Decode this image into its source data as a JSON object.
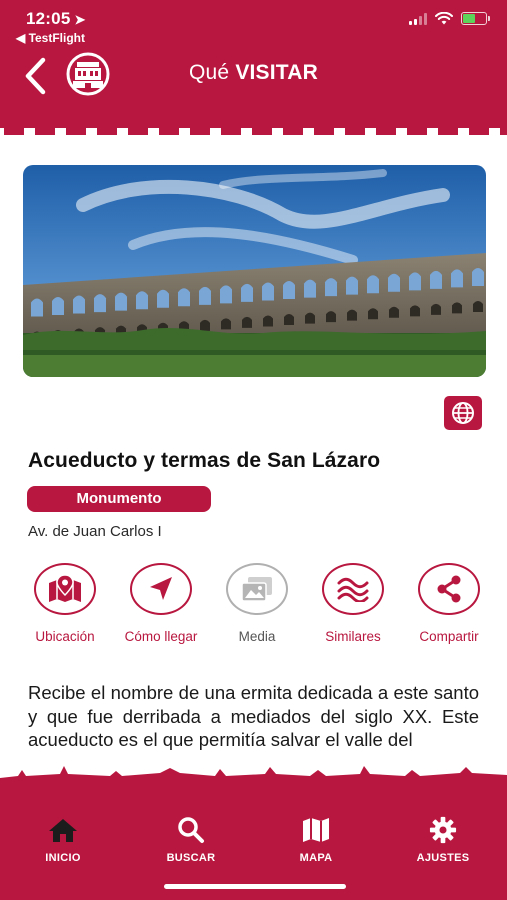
{
  "status_bar": {
    "time": "12:05",
    "back_app": "◀ TestFlight",
    "battery_level": 0.55
  },
  "header": {
    "title_regular": "Qué ",
    "title_bold": "VISITAR"
  },
  "place": {
    "name": "Acueducto y termas de San Lázaro",
    "category": "Monumento",
    "address": "Av. de Juan Carlos I"
  },
  "actions": [
    {
      "label": "Ubicación",
      "icon": "map-pin-icon"
    },
    {
      "label": "Cómo llegar",
      "icon": "navigation-arrow-icon"
    },
    {
      "label": "Media",
      "icon": "media-gallery-icon"
    },
    {
      "label": "Similares",
      "icon": "waves-icon"
    },
    {
      "label": "Compartir",
      "icon": "share-icon"
    }
  ],
  "description": "Recibe el nombre de una ermita dedicada a este santo y que fue derribada a mediados del siglo XX. Este acueducto es el que permitía salvar el valle del",
  "tabs": [
    {
      "label": "INICIO",
      "icon": "home-icon"
    },
    {
      "label": "BUSCAR",
      "icon": "search-icon"
    },
    {
      "label": "MAPA",
      "icon": "map-icon"
    },
    {
      "label": "AJUSTES",
      "icon": "gear-icon"
    }
  ],
  "colors": {
    "brand": "#b8173f",
    "muted": "#b0b0b0"
  }
}
